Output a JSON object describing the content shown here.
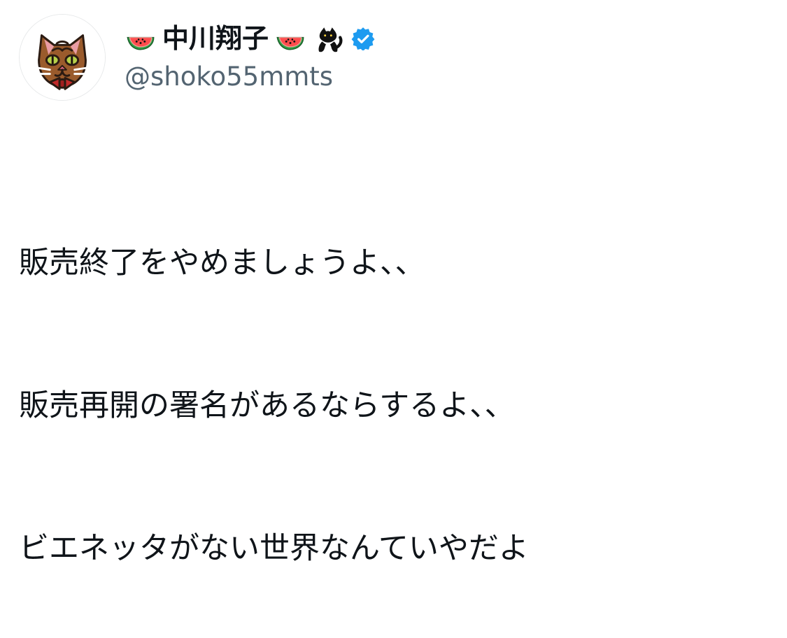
{
  "user": {
    "display_name": "中川翔子",
    "handle": "@shoko55mmts",
    "decorations": {
      "left_emoji": "watermelon-icon",
      "right_emoji_1": "watermelon-icon",
      "right_emoji_2": "black-cat-icon",
      "verified_icon": "verified-badge-icon"
    },
    "avatar_icon": "cat-with-bowtie-avatar"
  },
  "tweet": {
    "lines": [
      "販売終了をやめましょうよ、、",
      "販売再開の署名があるならするよ、、",
      "ビエネッタがない世界なんていやだよ"
    ]
  },
  "colors": {
    "text": "#0f1419",
    "secondary_text": "#536471",
    "verified_blue": "#1d9bf0",
    "background": "#ffffff"
  }
}
